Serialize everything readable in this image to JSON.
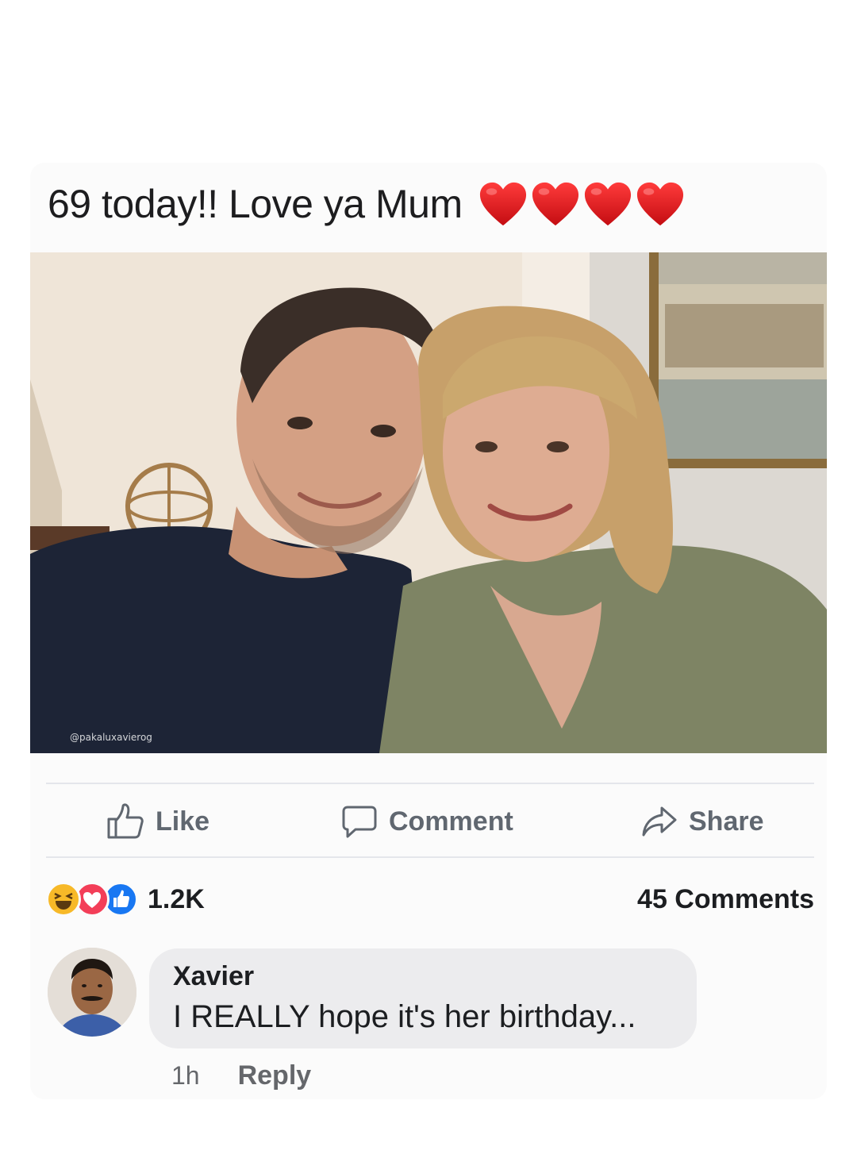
{
  "post": {
    "text": "69 today!! Love ya Mum",
    "emoji": [
      "heart-icon",
      "heart-icon",
      "heart-icon",
      "heart-icon"
    ],
    "heart_color": "#e0181f",
    "photo": {
      "watermark": "@pakaluxavierog",
      "description_icon": "photo-selfie"
    }
  },
  "actions": {
    "like_label": "Like",
    "comment_label": "Comment",
    "share_label": "Share"
  },
  "stats": {
    "reactions": [
      "haha-icon",
      "love-icon",
      "like-icon"
    ],
    "reaction_count": "1.2K",
    "comments_label": "45 Comments"
  },
  "comment": {
    "author": "Xavier",
    "text": "I REALLY hope it's her birthday...",
    "time": "1h",
    "reply_label": "Reply"
  },
  "colors": {
    "like_blue": "#1877f2",
    "love_red": "#f33e58",
    "haha_yellow": "#f7b928",
    "action_gray": "#606770"
  }
}
